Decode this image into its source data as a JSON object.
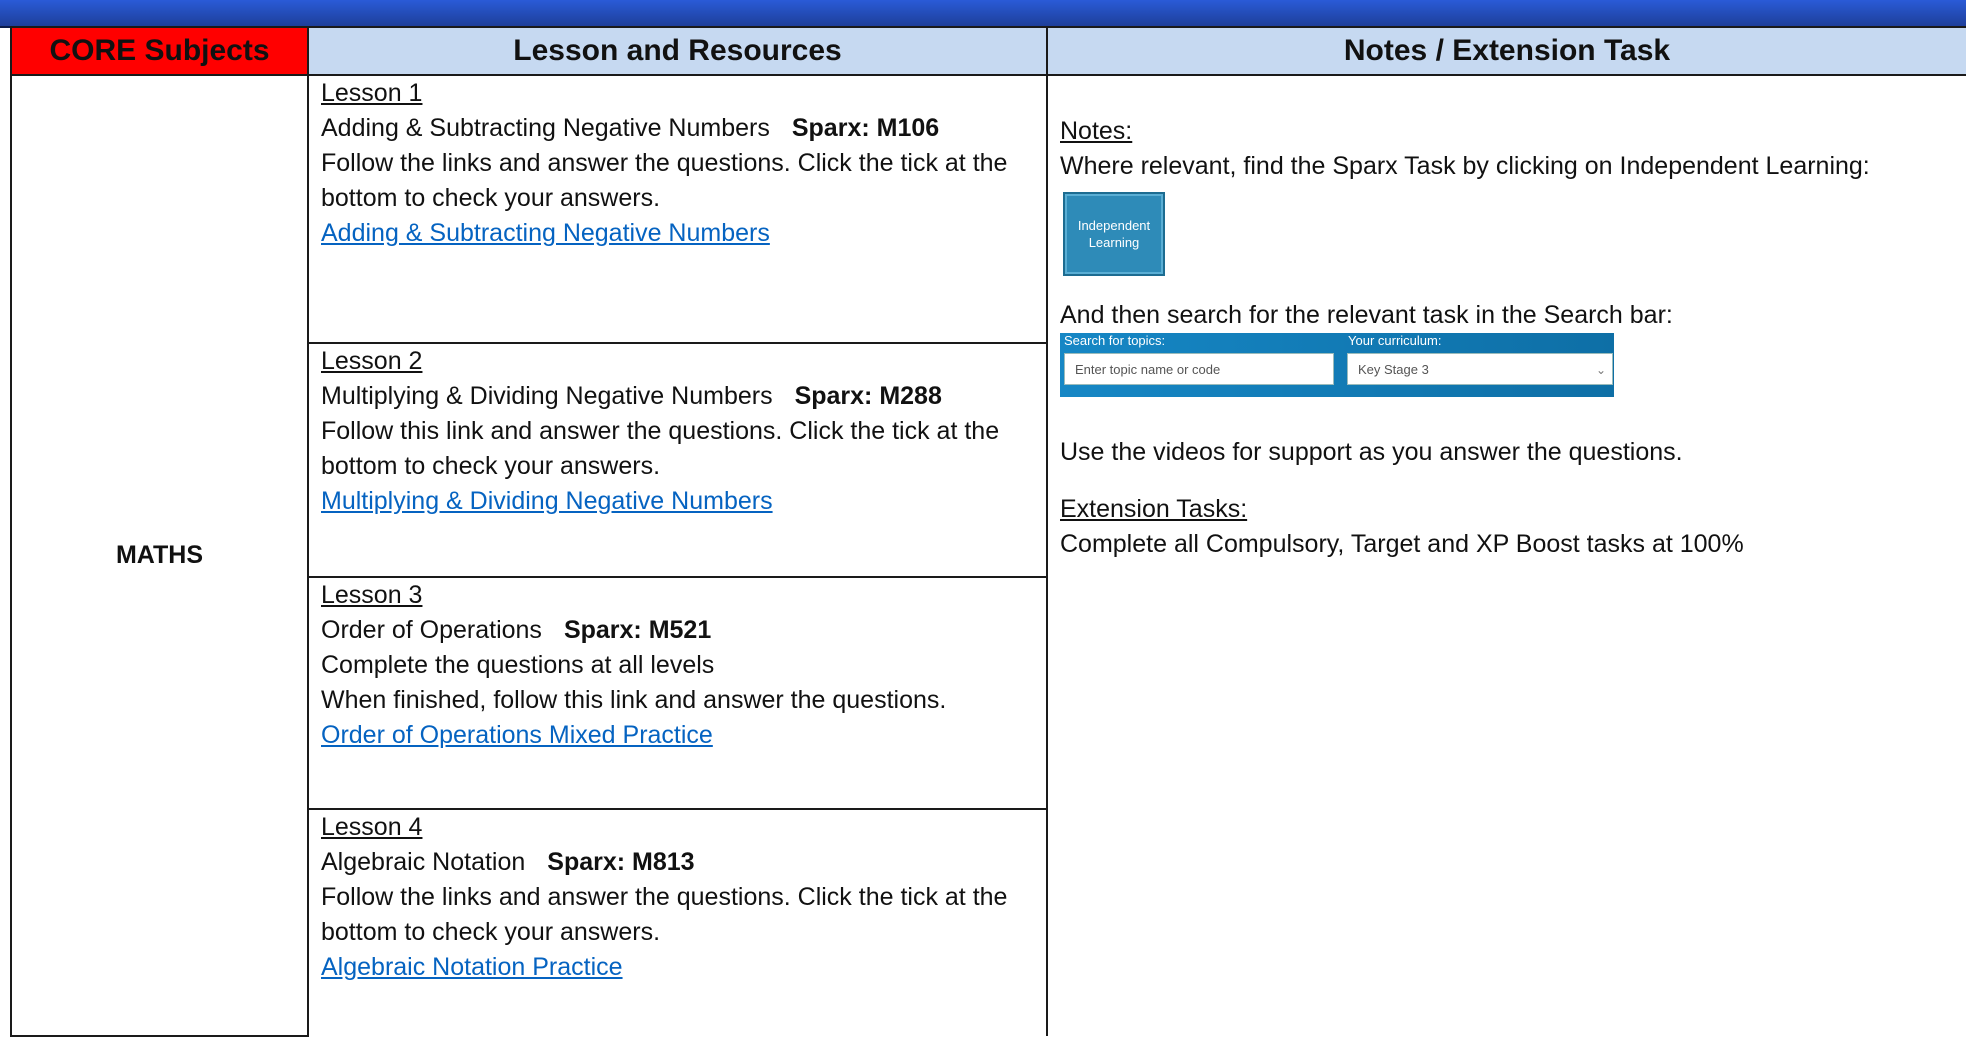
{
  "headers": {
    "core": "CORE Subjects",
    "lesson": "Lesson and Resources",
    "notes": "Notes / Extension Task"
  },
  "subject": "MATHS",
  "lessons": [
    {
      "label": "Lesson 1",
      "title": "Adding & Subtracting Negative Numbers",
      "sparx": "Sparx: M106",
      "instructions": [
        "Follow the links and answer the questions. Click the tick at the bottom to check your answers."
      ],
      "link": "Adding & Subtracting Negative Numbers"
    },
    {
      "label": "Lesson 2",
      "title": "Multiplying & Dividing Negative Numbers",
      "sparx": "Sparx: M288",
      "instructions": [
        "Follow this link and answer the questions. Click the tick at the bottom to check your answers."
      ],
      "link": "Multiplying & Dividing Negative Numbers"
    },
    {
      "label": "Lesson 3",
      "title": "Order of Operations",
      "sparx": "Sparx: M521",
      "instructions": [
        "Complete the questions at all levels",
        "When finished, follow this link and answer the questions."
      ],
      "link": "Order of Operations Mixed Practice"
    },
    {
      "label": "Lesson 4",
      "title": "Algebraic Notation",
      "sparx": "Sparx: M813",
      "instructions": [
        "Follow the links and answer the questions. Click the tick at the bottom to check your answers."
      ],
      "link": "Algebraic Notation Practice"
    }
  ],
  "notes": {
    "notes_heading": "Notes:",
    "notes_text": "Where relevant, find the Sparx Task by clicking on Independent Learning:",
    "independent_learning_button": "Independent Learning",
    "search_text": "And then search for the relevant task in the Search bar:",
    "search_bar": {
      "topics_label": "Search for topics:",
      "topics_placeholder": "Enter topic name or code",
      "curriculum_label": "Your curriculum:",
      "curriculum_value": "Key Stage 3"
    },
    "videos_text": "Use the videos for support as you answer the questions.",
    "extension_heading": "Extension Tasks:",
    "extension_text": "Complete all Compulsory, Target and XP Boost tasks at 100%"
  }
}
